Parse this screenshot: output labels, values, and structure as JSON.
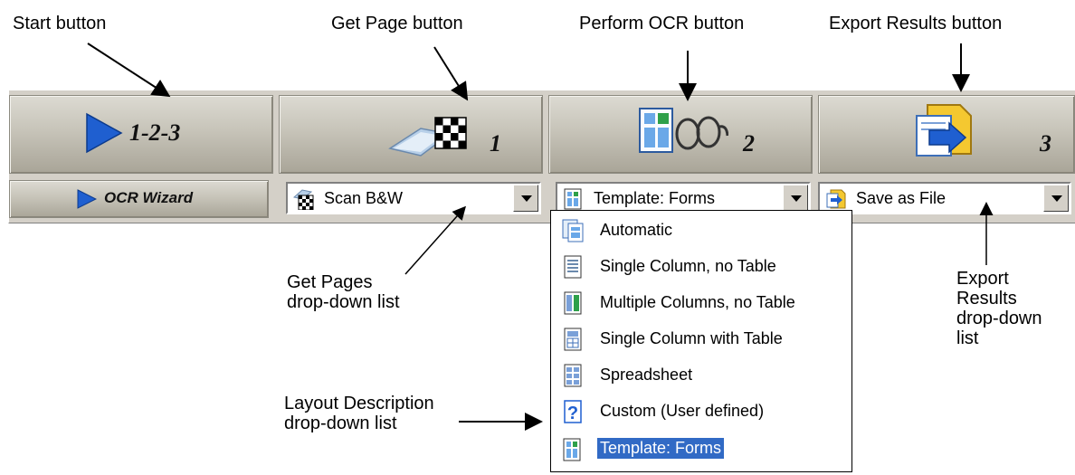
{
  "callouts": {
    "start": "Start button",
    "get_page": "Get Page button",
    "perform_ocr": "Perform OCR button",
    "export_results": "Export Results button",
    "get_pages_list_1": "Get Pages",
    "get_pages_list_2": "drop-down list",
    "layout_list_1": "Layout Description",
    "layout_list_2": "drop-down list",
    "export_list_1": "Export",
    "export_list_2": "Results",
    "export_list_3": "drop-down",
    "export_list_4": "list"
  },
  "toolbar": {
    "start_label": "1-2-3",
    "wizard_label": "OCR Wizard",
    "step1": "1",
    "step2": "2",
    "step3": "3",
    "get_page_value": "Scan B&W",
    "layout_value": "Template: Forms",
    "export_value": "Save as File"
  },
  "layout_options": [
    {
      "label": "Automatic",
      "icon": "automatic-icon",
      "selected": false
    },
    {
      "label": "Single Column, no Table",
      "icon": "single-column-icon",
      "selected": false
    },
    {
      "label": "Multiple Columns, no Table",
      "icon": "multiple-columns-icon",
      "selected": false
    },
    {
      "label": "Single Column with Table",
      "icon": "single-column-table-icon",
      "selected": false
    },
    {
      "label": "Spreadsheet",
      "icon": "spreadsheet-icon",
      "selected": false
    },
    {
      "label": "Custom (User defined)",
      "icon": "question-mark-icon",
      "selected": false
    },
    {
      "label": "Template: Forms",
      "icon": "template-forms-icon",
      "selected": true
    }
  ],
  "colors": {
    "toolbar_bg": "#d4d0c8",
    "accent_blue": "#1f5fd0",
    "selection": "#316ac5"
  }
}
